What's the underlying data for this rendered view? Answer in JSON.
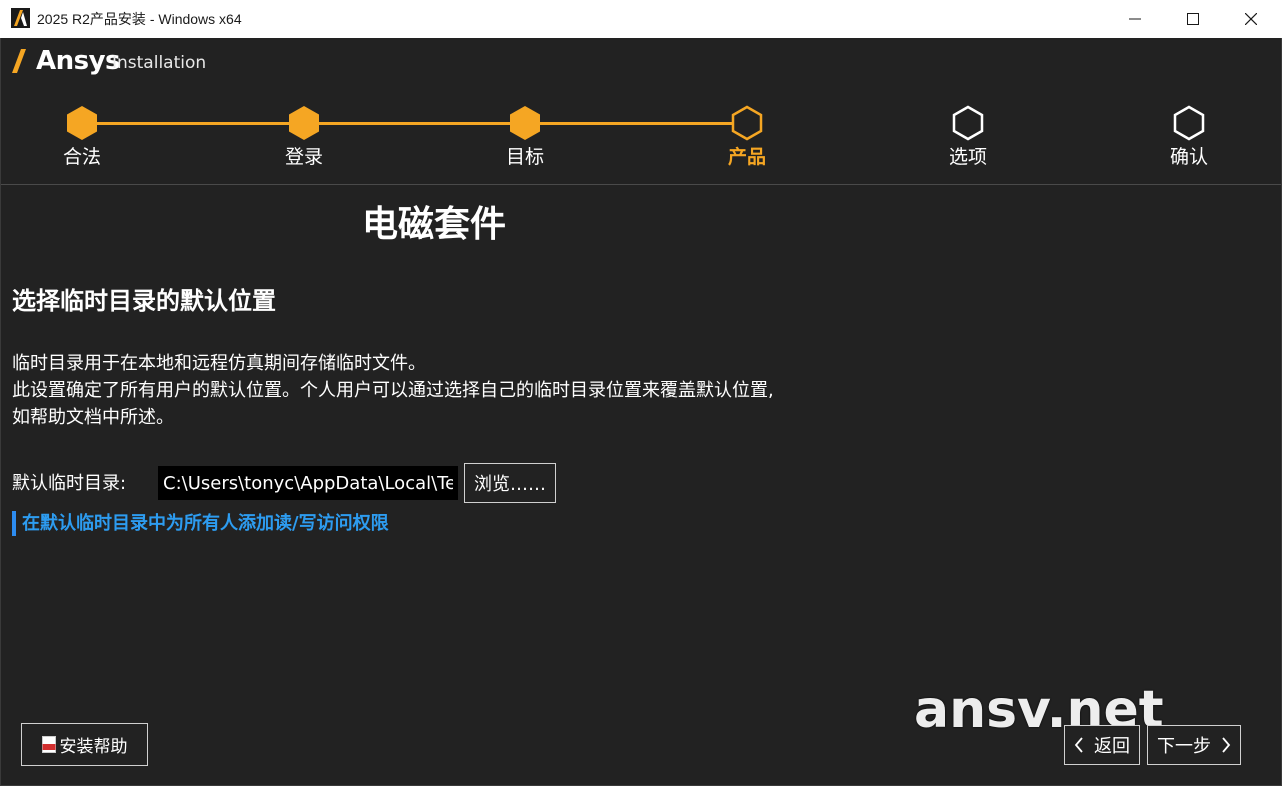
{
  "window": {
    "title": "2025 R2产品安装 - Windows x64",
    "minimize_icon": "minimize-icon",
    "maximize_icon": "maximize-icon",
    "close_icon": "close-icon"
  },
  "brand": {
    "logo_text": "Ansys",
    "subtitle": "Installation",
    "accent_color": "#f5a623"
  },
  "stepper": {
    "steps": [
      {
        "label": "合法",
        "state": "completed"
      },
      {
        "label": "登录",
        "state": "completed"
      },
      {
        "label": "目标",
        "state": "completed"
      },
      {
        "label": "产品",
        "state": "active"
      },
      {
        "label": "选项",
        "state": "pending"
      },
      {
        "label": "确认",
        "state": "pending"
      }
    ]
  },
  "content": {
    "suite_title": "电磁套件",
    "section_heading": "选择临时目录的默认位置",
    "description_lines": [
      "临时目录用于在本地和远程仿真期间存储临时文件。",
      "此设置确定了所有用户的默认位置。个人用户可以通过选择自己的临时目录位置来覆盖默认位置,",
      "如帮助文档中所述。"
    ],
    "dir_label": "默认临时目录:",
    "dir_value": "C:\\Users\\tonyc\\AppData\\Local\\Temp",
    "browse_label": "浏览……",
    "grant_access_label": "在默认临时目录中为所有人添加读/写访问权限",
    "link_color": "#2d9cf0"
  },
  "watermark": "ansv.net",
  "footer": {
    "help_label": "安装帮助",
    "back_label": "返回",
    "next_label": "下一步"
  }
}
